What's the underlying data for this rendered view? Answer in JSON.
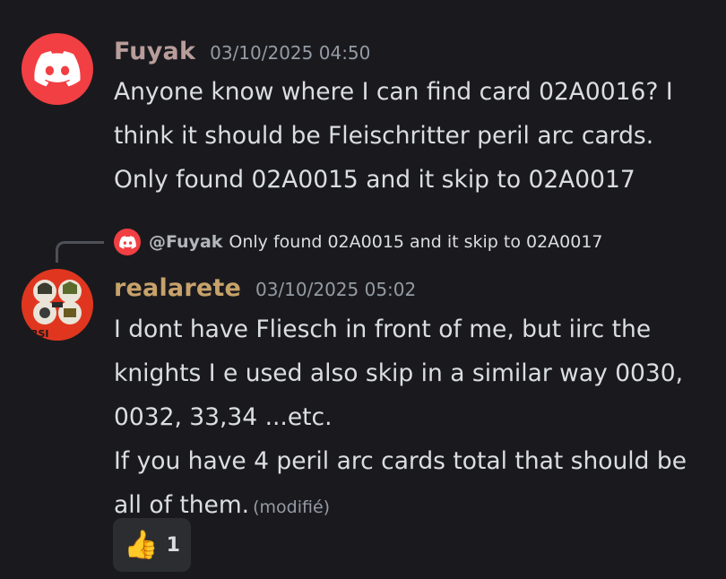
{
  "colors": {
    "background": "#1a1a1e",
    "discord_red": "#f23f43",
    "text": "#dbdee1",
    "muted": "#949ba4",
    "reaction_bg": "#2b2d31"
  },
  "messages": [
    {
      "username": "Fuyak",
      "username_color": "#b89d9a",
      "avatar_icon": "discord-logo-icon",
      "timestamp": "03/10/2025 04:50",
      "lines": [
        "Anyone know where I can find card 02A0016? I think it should be Fleischritter peril arc cards.",
        "Only found 02A0015 and it skip to 02A0017"
      ]
    },
    {
      "username": "realarete",
      "username_color": "#c7a26a",
      "avatar_icon": "custom-avatar-icon",
      "avatar_label": "RSI",
      "timestamp": "03/10/2025 05:02",
      "reply": {
        "mention": "@Fuyak",
        "text": "Only found 02A0015 and it skip to 02A0017"
      },
      "lines": [
        "I dont have Fliesch in front of me, but iirc the knights I e used also skip in a similar way 0030, 0032, 33,34 ...etc.",
        "If you have 4 peril arc cards total that should be all of them."
      ],
      "edited_label": "(modifié)",
      "reaction": {
        "emoji": "👍",
        "emoji_name": "thumbs-up-icon",
        "count": "1"
      }
    }
  ]
}
